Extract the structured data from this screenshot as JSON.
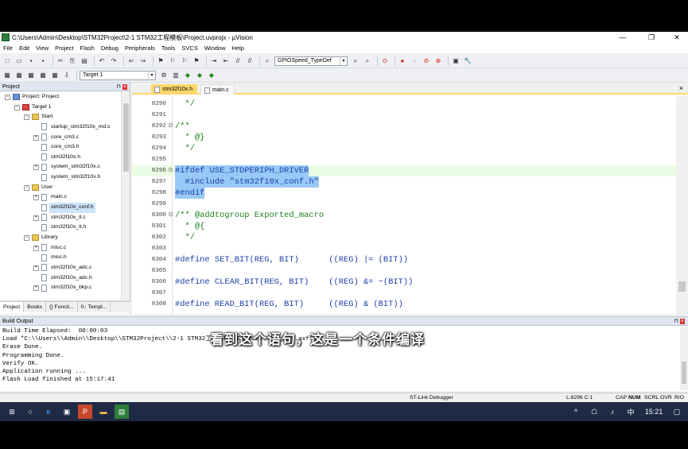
{
  "window": {
    "title": "C:\\Users\\Admin\\Desktop\\STM32Project\\2-1 STM32工程模板\\Project.uvprojx - µVision",
    "minimize": "—",
    "maximize": "❐",
    "close": "✕"
  },
  "menu": [
    "File",
    "Edit",
    "View",
    "Project",
    "Flash",
    "Debug",
    "Peripherals",
    "Tools",
    "SVCS",
    "Window",
    "Help"
  ],
  "toolbar": {
    "function_combo": "GPIOSpeed_TypeDef",
    "target_combo": "Target 1"
  },
  "project_panel": {
    "title": "Project",
    "tree": [
      {
        "label": "Project: Project",
        "level": 0,
        "kind": "proj",
        "exp": "−"
      },
      {
        "label": "Target 1",
        "level": 1,
        "kind": "target",
        "exp": "−"
      },
      {
        "label": "Start",
        "level": 2,
        "kind": "folder",
        "exp": "−"
      },
      {
        "label": "startup_stm32f10x_md.s",
        "level": 3,
        "kind": "file",
        "exp": ""
      },
      {
        "label": "core_cm3.c",
        "level": 3,
        "kind": "file",
        "exp": "+"
      },
      {
        "label": "core_cm3.h",
        "level": 3,
        "kind": "file",
        "exp": ""
      },
      {
        "label": "stm32f10x.h",
        "level": 3,
        "kind": "file",
        "exp": ""
      },
      {
        "label": "system_stm32f10x.c",
        "level": 3,
        "kind": "file",
        "exp": "+"
      },
      {
        "label": "system_stm32f10x.h",
        "level": 3,
        "kind": "file",
        "exp": ""
      },
      {
        "label": "User",
        "level": 2,
        "kind": "folder",
        "exp": "−"
      },
      {
        "label": "main.c",
        "level": 3,
        "kind": "file",
        "exp": "+"
      },
      {
        "label": "stm32f10x_conf.h",
        "level": 3,
        "kind": "file",
        "exp": "",
        "selected": true
      },
      {
        "label": "stm32f10x_it.c",
        "level": 3,
        "kind": "file",
        "exp": "+"
      },
      {
        "label": "stm32f10x_it.h",
        "level": 3,
        "kind": "file",
        "exp": ""
      },
      {
        "label": "Library",
        "level": 2,
        "kind": "folder",
        "exp": "−"
      },
      {
        "label": "misc.c",
        "level": 3,
        "kind": "file",
        "exp": "+"
      },
      {
        "label": "misc.h",
        "level": 3,
        "kind": "file",
        "exp": ""
      },
      {
        "label": "stm32f10x_adc.c",
        "level": 3,
        "kind": "file",
        "exp": "+"
      },
      {
        "label": "stm32f10x_adc.h",
        "level": 3,
        "kind": "file",
        "exp": ""
      },
      {
        "label": "stm32f10x_bkp.c",
        "level": 3,
        "kind": "file",
        "exp": "+"
      }
    ],
    "bottom_tabs": [
      "Project",
      "Books",
      "{} Functi...",
      "0↓ Templ..."
    ]
  },
  "editor": {
    "tabs": [
      {
        "label": "stm32f10x.h",
        "active": true
      },
      {
        "label": "main.c",
        "active": false
      }
    ],
    "lines": [
      {
        "n": "8290",
        "fold": "",
        "text": "  */",
        "cls": "cm"
      },
      {
        "n": "8291",
        "fold": "",
        "text": "",
        "cls": ""
      },
      {
        "n": "8292",
        "fold": "⊟",
        "text": "/**",
        "cls": "cm"
      },
      {
        "n": "8293",
        "fold": "",
        "text": "  * @}",
        "cls": "cm"
      },
      {
        "n": "8294",
        "fold": "",
        "text": "  */",
        "cls": "cm"
      },
      {
        "n": "8295",
        "fold": "",
        "text": "",
        "cls": ""
      },
      {
        "n": "8296",
        "fold": "⊟",
        "text": "#ifdef USE_STDPERIPH_DRIVER",
        "cls": "pp",
        "hl": true,
        "cur": true
      },
      {
        "n": "8297",
        "fold": "",
        "text": "  #include \"stm32f10x_conf.h\"",
        "cls": "pp",
        "hl": true
      },
      {
        "n": "8298",
        "fold": "",
        "text": "#endif",
        "cls": "pp",
        "hl": true
      },
      {
        "n": "8299",
        "fold": "",
        "text": "",
        "cls": ""
      },
      {
        "n": "8300",
        "fold": "⊟",
        "text": "/** @addtogroup Exported_macro",
        "cls": "cm"
      },
      {
        "n": "8301",
        "fold": "",
        "text": "  * @{",
        "cls": "cm"
      },
      {
        "n": "8302",
        "fold": "",
        "text": "  */",
        "cls": "cm"
      },
      {
        "n": "8303",
        "fold": "",
        "text": "",
        "cls": ""
      },
      {
        "n": "8304",
        "fold": "",
        "text": "#define SET_BIT(REG, BIT)      ((REG) |= (BIT))",
        "cls": "pp"
      },
      {
        "n": "8305",
        "fold": "",
        "text": "",
        "cls": ""
      },
      {
        "n": "8306",
        "fold": "",
        "text": "#define CLEAR_BIT(REG, BIT)    ((REG) &= ~(BIT))",
        "cls": "pp"
      },
      {
        "n": "8307",
        "fold": "",
        "text": "",
        "cls": ""
      },
      {
        "n": "8308",
        "fold": "",
        "text": "#define READ_BIT(REG, BIT)     ((REG) & (BIT))",
        "cls": "pp"
      }
    ]
  },
  "build_output": {
    "title": "Build Output",
    "text": "Build Time Elapsed:  00:00:03\nLoad \"C:\\\\Users\\\\Admin\\\\Desktop\\\\STM32Project\\\\2-1 STM32工程模板\\\\Objects\\\\Project.axf\"\nErase Done.\nProgramming Done.\nVerify OK.\nApplication running ...\nFlash Load finished at 15:17:41"
  },
  "subtitle": "看到这个语句，这是一个条件编译",
  "status": {
    "debugger": "ST-Link Debugger",
    "position": "L:8296 C:1",
    "cap": "CAP",
    "num": "NUM",
    "scrl": "SCRL",
    "ovr": "OVR",
    "rw": "R/O"
  },
  "taskbar": {
    "time": "15:21",
    "ime": "中"
  },
  "colors": {
    "selection": "#99c9f6",
    "active_tab": "#ffd86b",
    "taskbar": "#1f2a44"
  }
}
